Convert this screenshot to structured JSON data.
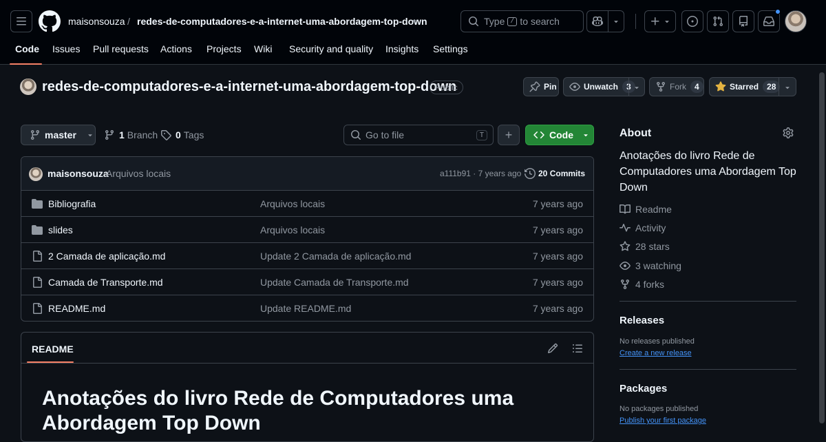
{
  "header": {
    "owner": "maisonsouza",
    "separator": "/",
    "repo": "redes-de-computadores-e-a-internet-uma-abordagem-top-down",
    "search_prefix": "Type",
    "search_key": "/",
    "search_suffix": "to search"
  },
  "nav": {
    "tabs": [
      "Code",
      "Issues",
      "Pull requests",
      "Actions",
      "Projects",
      "Wiki",
      "Security and quality",
      "Insights",
      "Settings"
    ],
    "active": "Code"
  },
  "repo": {
    "name": "redes-de-computadores-e-a-internet-uma-abordagem-top-down",
    "visibility": "Public",
    "pin_label": "Pin",
    "watch_label": "Unwatch",
    "watch_count": "3",
    "fork_label": "Fork",
    "fork_count": "4",
    "star_label": "Starred",
    "star_count": "28"
  },
  "branch_bar": {
    "branch": "master",
    "branches_count": "1",
    "branches_label": "Branch",
    "tags_count": "0",
    "tags_label": "Tags",
    "goto_placeholder": "Go to file",
    "goto_key": "T",
    "add_label": "+",
    "code_label": "Code"
  },
  "latest_commit": {
    "author": "maisonsouza",
    "message": "Arquivos locais",
    "hash_time": "a111b91 · 7 years ago",
    "commits_count": "20",
    "commits_label": "Commits"
  },
  "files": [
    {
      "type": "dir",
      "name": "Bibliografia",
      "message": "Arquivos locais",
      "age": "7 years ago"
    },
    {
      "type": "dir",
      "name": "slides",
      "message": "Arquivos locais",
      "age": "7 years ago"
    },
    {
      "type": "file",
      "name": "2 Camada de aplicação.md",
      "message": "Update 2 Camada de aplicação.md",
      "age": "7 years ago"
    },
    {
      "type": "file",
      "name": "Camada de Transporte.md",
      "message": "Update Camada de Transporte.md",
      "age": "7 years ago"
    },
    {
      "type": "file",
      "name": "README.md",
      "message": "Update README.md",
      "age": "7 years ago"
    }
  ],
  "readme": {
    "tab": "README",
    "heading": "Anotações do livro Rede de Computadores uma Abordagem Top Down"
  },
  "sidebar": {
    "about_title": "About",
    "description": "Anotações do livro Rede de Computadores uma Abordagem Top Down",
    "items": [
      {
        "icon": "book-icon",
        "label": "Readme"
      },
      {
        "icon": "pulse-icon",
        "label": "Activity"
      },
      {
        "icon": "star-icon",
        "label": "28 stars"
      },
      {
        "icon": "eye-icon",
        "label": "3 watching"
      },
      {
        "icon": "fork-icon",
        "label": "4 forks"
      }
    ],
    "releases_title": "Releases",
    "releases_empty": "No releases published",
    "releases_link": "Create a new release",
    "packages_title": "Packages",
    "packages_empty": "No packages published",
    "packages_link": "Publish your first package"
  },
  "colors": {
    "background": "#0d1117",
    "header_bg": "#010409",
    "border": "#3d444d",
    "accent_underline": "#f78166",
    "primary_button": "#238636",
    "link": "#4493f8",
    "muted_text": "#9198a1",
    "star_color": "#e3b341"
  }
}
